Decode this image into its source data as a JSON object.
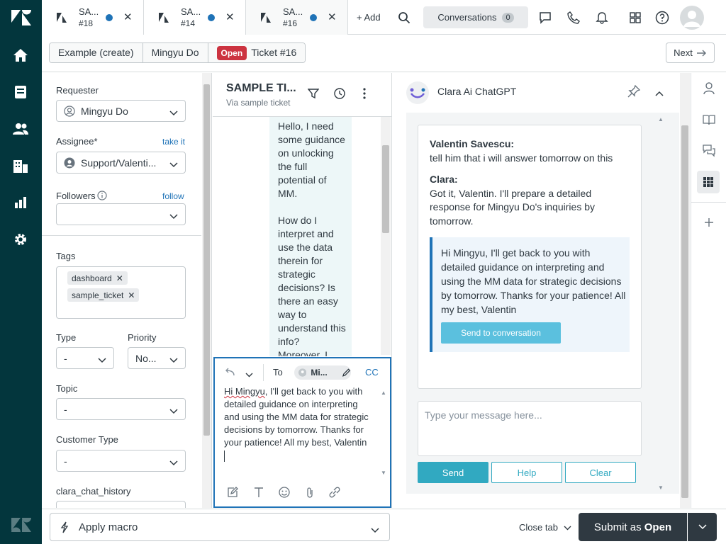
{
  "tabs": [
    {
      "title": "SA...",
      "number": "#18"
    },
    {
      "title": "SA...",
      "number": "#14"
    },
    {
      "title": "SA...",
      "number": "#16"
    }
  ],
  "topbar": {
    "add_label": "+ Add",
    "conversations_label": "Conversations",
    "conversations_count": "0"
  },
  "breadcrumb": {
    "item1": "Example (create)",
    "item2": "Mingyu Do",
    "status": "Open",
    "ticket": "Ticket #16",
    "next_label": "Next"
  },
  "properties": {
    "requester_label": "Requester",
    "requester_value": "Mingyu Do",
    "assignee_label": "Assignee*",
    "assignee_link": "take it",
    "assignee_value": "Support/Valenti...",
    "followers_label": "Followers",
    "followers_link": "follow",
    "tags_label": "Tags",
    "tags": [
      "dashboard",
      "sample_ticket"
    ],
    "type_label": "Type",
    "type_value": "-",
    "priority_label": "Priority",
    "priority_value": "No...",
    "topic_label": "Topic",
    "topic_value": "-",
    "customer_type_label": "Customer Type",
    "customer_type_value": "-",
    "chat_history_label": "clara_chat_history"
  },
  "conversation": {
    "title": "SAMPLE TI...",
    "subtitle": "Via sample ticket",
    "message_p1": "Hello, I need some guidance on unlocking the full potential of MM.",
    "message_p2": "How do I interpret and use the data therein for strategic decisions? Is there an easy way to understand this info? Moreover, I"
  },
  "composer": {
    "to_label": "To",
    "to_recipient": "Mi...",
    "cc_label": "CC",
    "text_first_word": "Hi Mingyu",
    "text_rest": ", I'll get back to you with detailed guidance on interpreting and using the MM data for strategic decisions by tomorrow. Thanks for your patience! All my best, Valentin"
  },
  "app": {
    "title": "Clara Ai ChatGPT",
    "msg1_author": "Valentin Savescu:",
    "msg1_text": "tell him that i will answer tomorrow on this",
    "msg2_author": "Clara:",
    "msg2_text": "Got it, Valentin. I'll prepare a detailed response for Mingyu Do's inquiries by tomorrow.",
    "draft": "Hi Mingyu, I'll get back to you with detailed guidance on interpreting and using the MM data for strategic decisions by tomorrow. Thanks for your patience! All my best, Valentin",
    "send_to_conversation": "Send to conversation",
    "input_placeholder": "Type your message here...",
    "send_label": "Send",
    "help_label": "Help",
    "clear_label": "Clear"
  },
  "footer": {
    "macro_label": "Apply macro",
    "close_tab_label": "Close tab",
    "submit_prefix": "Submit as",
    "submit_status": "Open"
  },
  "colors": {
    "nav_bg": "#03363d",
    "accent": "#1f73b7",
    "open_badge": "#cc3340",
    "send_btn": "#31a9c1",
    "submit_bg": "#2f3941"
  }
}
